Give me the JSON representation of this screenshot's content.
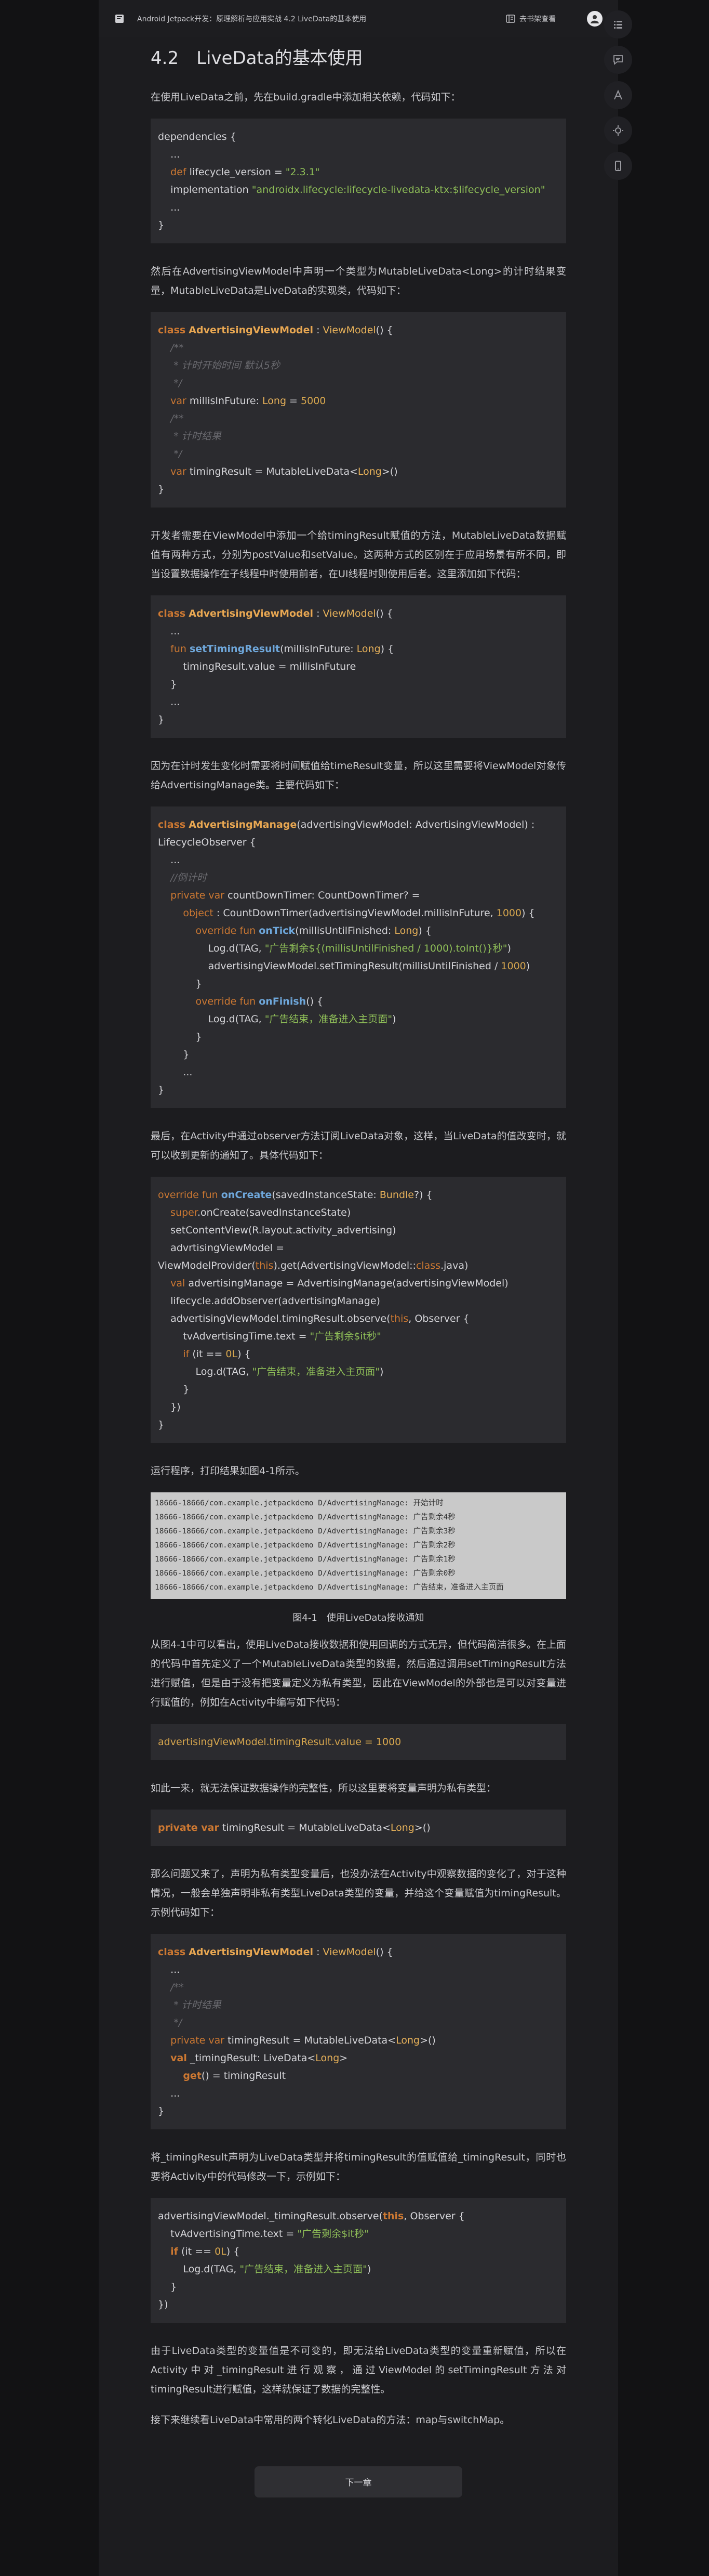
{
  "header": {
    "title": "Android Jetpack开发：原理解析与应用实战 4.2 LiveData的基本使用",
    "shelf_label": "去书架查看"
  },
  "section": {
    "heading": "4.2　LiveData的基本使用",
    "p1": "在使用LiveData之前，先在build.gradle中添加相关依赖，代码如下：",
    "p2": "然后在AdvertisingViewModel中声明一个类型为MutableLiveData<Long>的计时结果变量，MutableLiveData是LiveData的实现类，代码如下：",
    "p3": "开发者需要在ViewModel中添加一个给timingResult赋值的方法，MutableLiveData数据赋值有两种方式，分别为postValue和setValue。这两种方式的区别在于应用场景有所不同，即当设置数据操作在子线程中时使用前者，在UI线程时则使用后者。这里添加如下代码：",
    "p4": "因为在计时发生变化时需要将时间赋值给timeResult变量，所以这里需要将ViewModel对象传给AdvertisingManage类。主要代码如下：",
    "p5": "最后，在Activity中通过observer方法订阅LiveData对象，这样，当LiveData的值改变时，就可以收到更新的通知了。具体代码如下：",
    "p6": "运行程序，打印结果如图4-1所示。",
    "figure_caption": "图4-1　使用LiveData接收通知",
    "p7": "从图4-1中可以看出，使用LiveData接收数据和使用回调的方式无异，但代码简洁很多。在上面的代码中首先定义了一个MutableLiveData类型的数据，然后通过调用setTimingResult方法进行赋值，但是由于没有把变量定义为私有类型，因此在ViewModel的外部也是可以对变量进行赋值的，例如在Activity中编写如下代码：",
    "p8": "如此一来，就无法保证数据操作的完整性，所以这里要将变量声明为私有类型：",
    "p9": "那么问题又来了，声明为私有类型变量后，也没办法在Activity中观察数据的变化了，对于这种情况，一般会单独声明非私有类型LiveData类型的变量，并给这个变量赋值为timingResult。示例代码如下：",
    "p10": "将_timingResult声明为LiveData类型并将timingResult的值赋值给_timingResult，同时也要将Activity中的代码修改一下，示例如下：",
    "p11": "由于LiveData类型的变量值是不可变的，即无法给LiveData类型的变量重新赋值，所以在Activity中对_timingResult进行观察，通过ViewModel的setTimingResult方法对timingResult进行赋值，这样就保证了数据的完整性。",
    "p12": "接下来继续看LiveData中常用的两个转化LiveData的方法：map与switchMap。"
  },
  "code1": [
    "dependencies {",
    "    ...",
    "    def lifecycle_version = \"2.3.1\"",
    "    implementation \"androidx.lifecycle:lifecycle-livedata-ktx:$lifecycle_version\"",
    "    ...",
    "}"
  ],
  "code2": {
    "l1a": "class",
    "l1b": "AdvertisingViewModel",
    "l1c": " : ",
    "l1d": "ViewModel",
    "l1e": "() {",
    "c1": "/**",
    "c2": " * 计时开始时间 默认5秒",
    "c3": " */",
    "l5a": "var",
    "l5b": " millisInFuture: ",
    "l5c": "Long",
    "l5d": " = ",
    "l5e": "5000",
    "c4": "/**",
    "c5": " * 计时结果",
    "c6": " */",
    "l9a": "var",
    "l9b": " timingResult = MutableLiveData<",
    "l9c": "Long",
    "l9d": ">()",
    "close": "}"
  },
  "code3": {
    "l1a": "class",
    "l1b": "AdvertisingViewModel",
    "l1c": " : ",
    "l1d": "ViewModel",
    "l1e": "() {",
    "dots": "...",
    "l3a": "fun",
    "l3b": "setTimingResult",
    "l3c": "(millisInFuture: ",
    "l3d": "Long",
    "l3e": ") {",
    "l4": "timingResult.value = millisInFuture",
    "l5": "}",
    "dots2": "...",
    "close": "}"
  },
  "code4": {
    "l1a": "class",
    "l1b": "AdvertisingManage",
    "l1c": "(advertisingViewModel: AdvertisingViewModel) : LifecycleObserver {",
    "dots": "...",
    "cmt": "//倒计时",
    "l4a": "private var",
    "l4b": " countDownTimer: CountDownTimer? =",
    "l5a": "object",
    "l5b": " : CountDownTimer(advertisingViewModel.millisInFuture, ",
    "l5c": "1000",
    "l5d": ") {",
    "l6a": "override fun",
    "l6b": "onTick",
    "l6c": "(millisUntilFinished: ",
    "l6d": "Long",
    "l6e": ") {",
    "l7a": "Log.d(TAG, ",
    "l7b": "\"广告剩余${(millisUntilFinished / 1000).toInt()}秒\"",
    "l7c": ")",
    "l8a": "advertisingViewModel.setTimingResult(millisUntilFinished / ",
    "l8b": "1000",
    "l8c": ")",
    "l9": "}",
    "l10a": "override fun",
    "l10b": "onFinish",
    "l10c": "() {",
    "l11a": "Log.d(TAG, ",
    "l11b": "\"广告结束，准备进入主页面\"",
    "l11c": ")",
    "l12": "}",
    "l13": "}",
    "dots2": "...",
    "close": "}"
  },
  "code5": {
    "l1a": "override fun",
    "l1b": "onCreate",
    "l1c": "(savedInstanceState: ",
    "l1d": "Bundle",
    "l1e": "?) {",
    "l2a": "super",
    "l2b": ".onCreate(savedInstanceState)",
    "l3": "setContentView(R.layout.activity_advertising)",
    "l4a": "advrtisingViewModel = ViewModelProvider(",
    "l4b": "this",
    "l4c": ").get(AdvertisingViewModel::",
    "l4d": "class",
    "l4e": ".java)",
    "l5a": "val",
    "l5b": " advertisingManage = AdvertisingManage(advertisingViewModel)",
    "l6": "lifecycle.addObserver(advertisingManage)",
    "l7a": "advertisingViewModel.timingResult.observe(",
    "l7b": "this",
    "l7c": ", Observer {",
    "l8a": "tvAdvertisingTime.text = ",
    "l8b": "\"广告剩余$it秒\"",
    "l9a": "if",
    "l9b": " (it == ",
    "l9c": "0L",
    "l9d": ") {",
    "l10a": "Log.d(TAG, ",
    "l10b": "\"广告结束，准备进入主页面\"",
    "l10c": ")",
    "l11": "}",
    "l12": "})",
    "close": "}"
  },
  "terminal_lines": [
    "18666-18666/com.example.jetpackdemo D/AdvertisingManage: 开始计时",
    "18666-18666/com.example.jetpackdemo D/AdvertisingManage: 广告剩余4秒",
    "18666-18666/com.example.jetpackdemo D/AdvertisingManage: 广告剩余3秒",
    "18666-18666/com.example.jetpackdemo D/AdvertisingManage: 广告剩余2秒",
    "18666-18666/com.example.jetpackdemo D/AdvertisingManage: 广告剩余1秒",
    "18666-18666/com.example.jetpackdemo D/AdvertisingManage: 广告剩余0秒",
    "18666-18666/com.example.jetpackdemo D/AdvertisingManage: 广告结束，准备进入主页面"
  ],
  "code6": "advertisingViewModel.timingResult.value = 1000",
  "code7": {
    "a": "private var",
    "b": " timingResult = MutableLiveData<",
    "c": "Long",
    "d": ">()"
  },
  "code8": {
    "l1a": "class",
    "l1b": "AdvertisingViewModel",
    "l1c": " : ",
    "l1d": "ViewModel",
    "l1e": "() {",
    "dots": "...",
    "c1": "/**",
    "c2": " * 计时结果",
    "c3": " */",
    "l6a": "private var",
    "l6b": " timingResult = MutableLiveData<",
    "l6c": "Long",
    "l6d": ">()",
    "l7a": "val",
    "l7b": " _timingResult: LiveData<",
    "l7c": "Long",
    "l7d": ">",
    "l8a": "get",
    "l8b": "() = timingResult",
    "dots2": "...",
    "close": "}"
  },
  "code9": {
    "l1a": "advertisingViewModel._timingResult.observe(",
    "l1b": "this",
    "l1c": ", Observer {",
    "l2a": "tvAdvertisingTime.text = ",
    "l2b": "\"广告剩余$it秒\"",
    "l3a": "if",
    "l3b": " (it == ",
    "l3c": "0L",
    "l3d": ") {",
    "l4a": "Log.d(TAG, ",
    "l4b": "\"广告结束，准备进入主页面\"",
    "l4c": ")",
    "l5": "}",
    "l6": "})"
  },
  "next_button": "下一章",
  "icons": [
    "book-icon",
    "bookshelf-icon",
    "avatar-icon",
    "list-icon",
    "comment-icon",
    "font-icon",
    "brightness-icon",
    "phone-icon"
  ]
}
